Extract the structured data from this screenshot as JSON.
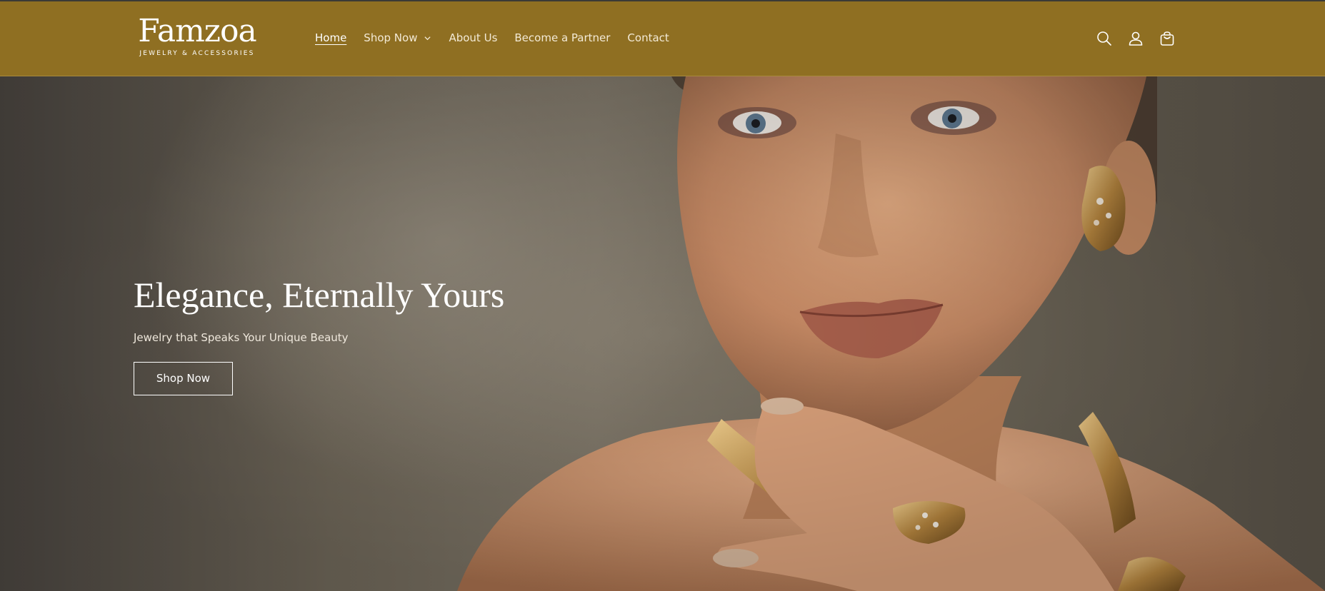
{
  "brand": {
    "name": "Famzoa",
    "tagline": "JEWELRY & ACCESSORIES"
  },
  "nav": {
    "items": [
      {
        "label": "Home",
        "active": true
      },
      {
        "label": "Shop Now",
        "has_dropdown": true
      },
      {
        "label": "About Us"
      },
      {
        "label": "Become a Partner"
      },
      {
        "label": "Contact"
      }
    ]
  },
  "header_icons": [
    "search-icon",
    "account-icon",
    "cart-icon"
  ],
  "hero": {
    "title": "Elegance, Eternally Yours",
    "subtitle": "Jewelry that Speaks Your Unique Beauty",
    "cta_label": "Shop Now"
  },
  "colors": {
    "header_bg": "#8f6f22",
    "text_light": "#ffffff",
    "hero_bg": "#6e655a"
  }
}
